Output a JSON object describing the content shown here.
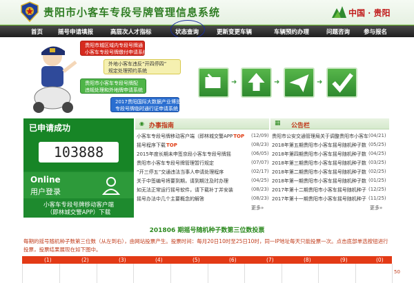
{
  "header": {
    "title": "贵阳市小客车专段号牌管理信息系统",
    "brand": "中国 · 贵阳"
  },
  "nav": [
    {
      "label": "首页"
    },
    {
      "label": "摇号申请填报"
    },
    {
      "label": "高层次人才指标"
    },
    {
      "label": "状态查询"
    },
    {
      "label": "更新变更车辆"
    },
    {
      "label": "车辆预约办理"
    },
    {
      "label": "问题咨询"
    },
    {
      "label": "参与报名"
    }
  ],
  "banner": {
    "pills": [
      "贵阳市城区域内专段号牌通|小客车专段号牌缴付申请系统",
      "外地小客车违反“开四停四”|规定处理预约系统",
      "贵阳市小客车专段号牌配|违规处理和外地牌申请系统",
      "2017贵阳国际大数据产业博览会|专段号牌临时通行证申请系统"
    ]
  },
  "left_panel": {
    "status": "已申请成功",
    "count": "103888",
    "online": "Online",
    "login": "用户登录",
    "app_line1": "小客车专段号牌移动客户端",
    "app_line2": "（即林城交警APP）下载"
  },
  "guide": {
    "title": "办事指南",
    "items": [
      {
        "text": "小客车专段号牌移动客户端（即林城交警APP",
        "tag": "TOP",
        "date": "(12/09)"
      },
      {
        "text": "摇号程序下载",
        "tag": "TOP",
        "date": "(08/23)"
      },
      {
        "text": "2015年度长期未申签京段小客车专段号牌摇",
        "tag": "",
        "date": "(06/05)"
      },
      {
        "text": "贵阳市小客车专段号牌管理暂行规定",
        "tag": "",
        "date": "(07/07)"
      },
      {
        "text": "“开三停五”交通违法当事人申请处理程序",
        "tag": "",
        "date": "(02/17)"
      },
      {
        "text": "关于中签编号将要到期，请到期注及时办理",
        "tag": "",
        "date": "(04/25)"
      },
      {
        "text": "如无法正常运行摇号软件，请下载补丁并安装",
        "tag": "",
        "date": "(08/23)"
      },
      {
        "text": "摇号办法中几个主要概念的解答",
        "tag": "",
        "date": "(08/23)"
      }
    ],
    "more": "更多»"
  },
  "notice": {
    "title": "公告栏",
    "items": [
      {
        "text": "贵阳市公安交通管理局关于调整贵阳市小客车",
        "date": "(04/21)"
      },
      {
        "text": "2018年第五期贵阳市小客车摇号随机种子数",
        "date": "(05/25)"
      },
      {
        "text": "2018年第四期贵阳市小客车摇号随机种子数",
        "date": "(04/25)"
      },
      {
        "text": "2018年第三期贵阳市小客车摇号随机种子数",
        "date": "(03/25)"
      },
      {
        "text": "2018年第二期贵阳市小客车摇号随机种子数",
        "date": "(02/25)"
      },
      {
        "text": "2018年第一期贵阳市小客车摇号随机种子数",
        "date": "(01/25)"
      },
      {
        "text": "2017年第十二期贵阳市小客车摇号随机种子",
        "date": "(12/25)"
      },
      {
        "text": "2017年第十一期贵阳市小客车摇号随机种子",
        "date": "(11/25)"
      }
    ],
    "more": "更多»"
  },
  "lottery": {
    "title": "201806 期摇号随机种子数第三位数投票",
    "desc": "每期的摇号随机种子数第三位数（从左到右），由网站投票产生。投票时间：每月20日10时至25日10时，同一IP地址每天只能投票一次。点击底部单选按钮进行投票，投票结果展现在如下图中。",
    "columns": [
      "(1)",
      "(2)",
      "(3)",
      "(4)",
      "(5)",
      "(6)",
      "(7)",
      "(8)",
      "(9)",
      "(0)"
    ],
    "axis_value": "50"
  }
}
